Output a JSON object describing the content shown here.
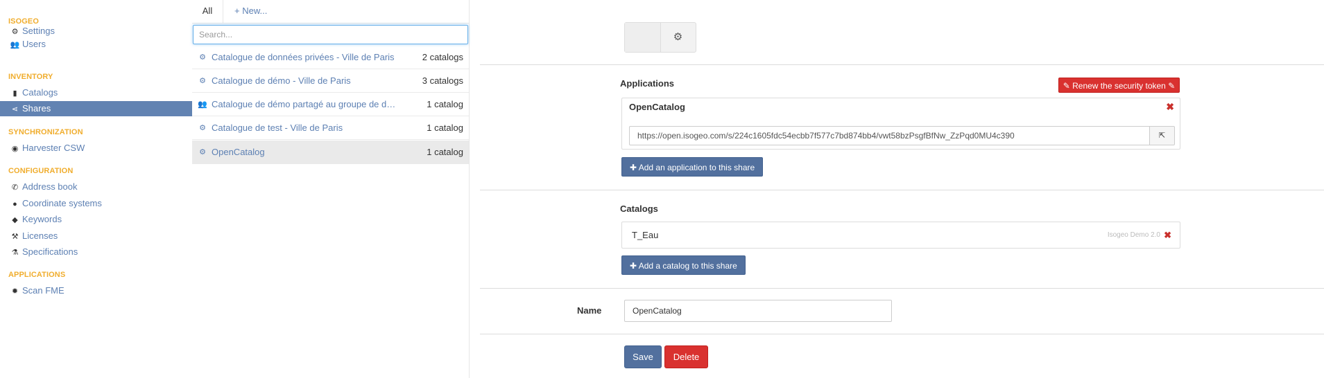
{
  "nav": {
    "sections": [
      {
        "label": "ISOGEO"
      },
      {
        "label": "INVENTORY"
      },
      {
        "label": "SYNCHRONIZATION"
      },
      {
        "label": "CONFIGURATION"
      },
      {
        "label": "APPLICATIONS"
      }
    ],
    "items": [
      {
        "label": "Settings",
        "icon": "gears-icon",
        "glyph": "⚙"
      },
      {
        "label": "Users",
        "icon": "users-icon",
        "glyph": "👥"
      },
      {
        "label": "Catalogs",
        "icon": "book-icon",
        "glyph": "▮"
      },
      {
        "label": "Shares",
        "icon": "share-icon",
        "glyph": "⋖"
      },
      {
        "label": "Harvester CSW",
        "icon": "eye-icon",
        "glyph": "◉"
      },
      {
        "label": "Address book",
        "icon": "phone-icon",
        "glyph": "✆"
      },
      {
        "label": "Coordinate systems",
        "icon": "globe-icon",
        "glyph": "●"
      },
      {
        "label": "Keywords",
        "icon": "tags-icon",
        "glyph": "◆"
      },
      {
        "label": "Licenses",
        "icon": "gavel-icon",
        "glyph": "⚒"
      },
      {
        "label": "Specifications",
        "icon": "flask-icon",
        "glyph": "⚗"
      },
      {
        "label": "Scan FME",
        "icon": "cog-icon",
        "glyph": "✹"
      }
    ],
    "active_item": "Shares"
  },
  "list": {
    "tab_all": "All",
    "tab_new": "+ New...",
    "search_placeholder": "Search...",
    "rows": [
      {
        "title": "Catalogue de données privées - Ville de Paris",
        "count": "2 catalogs",
        "icon": "gears-icon",
        "glyph": "⚙"
      },
      {
        "title": "Catalogue de démo - Ville de Paris",
        "count": "3 catalogs",
        "icon": "gears-icon",
        "glyph": "⚙"
      },
      {
        "title": "Catalogue de démo partagé au groupe de démonstration",
        "count": "1 catalog",
        "icon": "users-icon",
        "glyph": "👥"
      },
      {
        "title": "Catalogue de test - Ville de Paris",
        "count": "1 catalog",
        "icon": "gears-icon",
        "glyph": "⚙"
      },
      {
        "title": "OpenCatalog",
        "count": "1 catalog",
        "icon": "gears-icon",
        "glyph": "⚙"
      }
    ],
    "selected_row": "OpenCatalog"
  },
  "detail": {
    "type_toggle_glyph": "⚙",
    "applications": {
      "title": "Applications",
      "renew_label": "✎ Renew the security token ✎",
      "app_name": "OpenCatalog",
      "remove_glyph": "✖",
      "url": "https://open.isogeo.com/s/224c1605fdc54ecbb7f577c7bd874bb4/vwt58bzPsgfBfNw_ZzPqd0MU4c390",
      "open_glyph": "⇱",
      "add_label": "✚ Add an application to this share"
    },
    "catalogs": {
      "title": "Catalogs",
      "items": [
        {
          "name": "T_Eau",
          "source": "Isogeo Demo 2.0"
        }
      ],
      "remove_glyph": "✖",
      "add_label": "✚ Add a catalog to this share"
    },
    "name": {
      "label": "Name",
      "value": "OpenCatalog"
    },
    "save_label": "Save",
    "delete_label": "Delete"
  },
  "colors": {
    "accent": "#6283b2",
    "link": "#5d80b3",
    "section": "#f0ad2d",
    "danger": "#d9312f",
    "primary_button": "#52709e"
  }
}
